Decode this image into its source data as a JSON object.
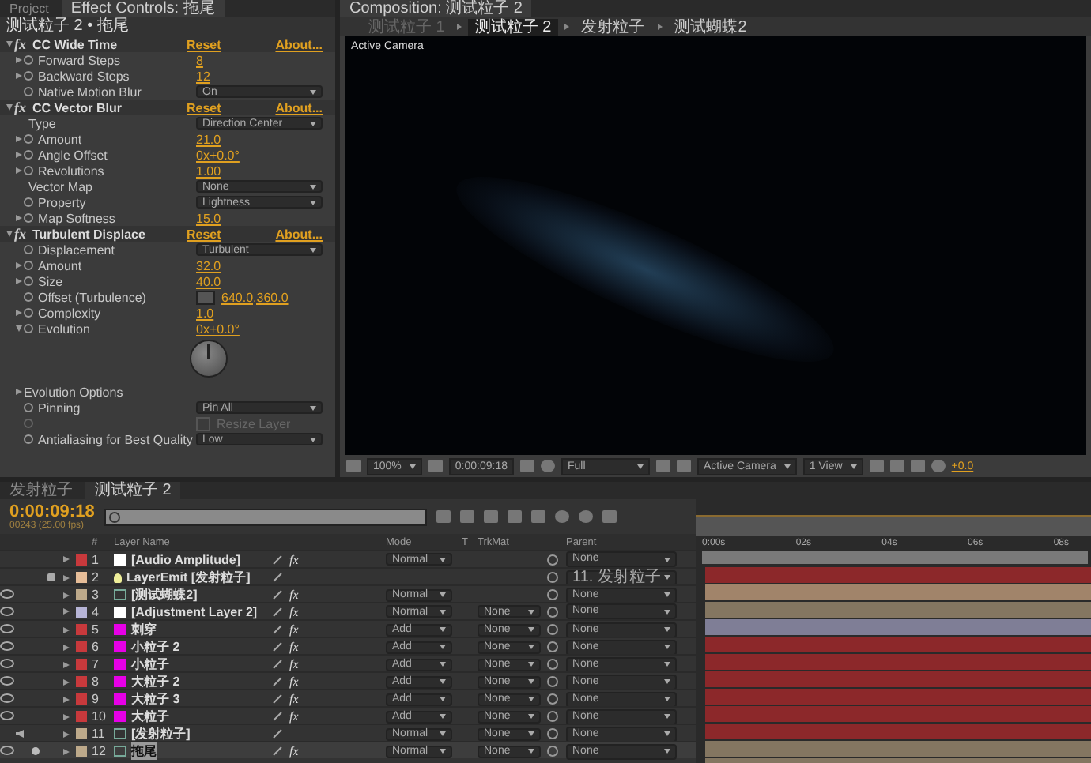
{
  "effect_panel": {
    "tabs": [
      {
        "label": "Project",
        "selected": false
      },
      {
        "label": "Effect Controls: 拖尾",
        "selected": true
      }
    ],
    "header": "测试粒子 2 • 拖尾",
    "effects": [
      {
        "name": "CC Wide Time",
        "badge": "fx",
        "reset": "Reset",
        "about": "About...",
        "expanded": true,
        "properties": [
          {
            "kind": "value",
            "label": "Forward Steps",
            "value": "8",
            "expander": true,
            "expanded": false,
            "stopwatch": true
          },
          {
            "kind": "value",
            "label": "Backward Steps",
            "value": "12",
            "expander": true,
            "expanded": false,
            "stopwatch": true
          },
          {
            "kind": "dropdown",
            "label": "Native Motion Blur",
            "value": "On",
            "expander": false,
            "stopwatch": true
          }
        ]
      },
      {
        "name": "CC Vector Blur",
        "badge": "fx",
        "reset": "Reset",
        "about": "About...",
        "expanded": true,
        "properties": [
          {
            "kind": "dropdown",
            "label": "Type",
            "value": "Direction Center",
            "expander": false,
            "stopwatch": false
          },
          {
            "kind": "value",
            "label": "Amount",
            "value": "21.0",
            "expander": true,
            "expanded": false,
            "stopwatch": true
          },
          {
            "kind": "value",
            "label": "Angle Offset",
            "value": "0x+0.0°",
            "expander": true,
            "expanded": false,
            "stopwatch": true
          },
          {
            "kind": "value",
            "label": "Revolutions",
            "value": "1.00",
            "expander": true,
            "expanded": false,
            "stopwatch": true
          },
          {
            "kind": "dropdown",
            "label": "Vector Map",
            "value": "None",
            "expander": false,
            "stopwatch": false
          },
          {
            "kind": "dropdown",
            "label": "Property",
            "value": "Lightness",
            "expander": false,
            "stopwatch": true
          },
          {
            "kind": "value",
            "label": "Map Softness",
            "value": "15.0",
            "expander": true,
            "expanded": false,
            "stopwatch": true
          }
        ]
      },
      {
        "name": "Turbulent Displace",
        "badge": "fx",
        "reset": "Reset",
        "about": "About...",
        "expanded": true,
        "properties": [
          {
            "kind": "dropdown",
            "label": "Displacement",
            "value": "Turbulent",
            "expander": false,
            "stopwatch": true
          },
          {
            "kind": "value",
            "label": "Amount",
            "value": "32.0",
            "expander": true,
            "expanded": false,
            "stopwatch": true
          },
          {
            "kind": "value",
            "label": "Size",
            "value": "40.0",
            "expander": true,
            "expanded": false,
            "stopwatch": true
          },
          {
            "kind": "point",
            "label": "Offset (Turbulence)",
            "value": "640.0,360.0",
            "expander": false,
            "stopwatch": true
          },
          {
            "kind": "value",
            "label": "Complexity",
            "value": "1.0",
            "expander": true,
            "expanded": false,
            "stopwatch": true
          },
          {
            "kind": "angle",
            "label": "Evolution",
            "value": "0x+0.0°",
            "expander": true,
            "expanded": true,
            "stopwatch": true
          },
          {
            "kind": "group",
            "label": "Evolution Options",
            "expander": true,
            "expanded": false,
            "stopwatch": false
          },
          {
            "kind": "dropdown",
            "label": "Pinning",
            "value": "Pin All",
            "expander": false,
            "stopwatch": true
          },
          {
            "kind": "checkbox",
            "label": "Resize Layer",
            "checked": false,
            "disabled": true,
            "expander": false,
            "stopwatch": true
          },
          {
            "kind": "dropdown",
            "label": "Antialiasing for Best Quality",
            "value": "Low",
            "expander": false,
            "stopwatch": true
          }
        ]
      }
    ]
  },
  "composition": {
    "tab": "Composition: 测试粒子 2",
    "breadcrumbs": [
      {
        "label": "测试粒子 1",
        "selected": false,
        "dimmed": true
      },
      {
        "label": "测试粒子 2",
        "selected": true,
        "dimmed": false
      },
      {
        "label": "发射粒子",
        "selected": false,
        "dimmed": false
      },
      {
        "label": "测试蝴蝶2",
        "selected": false,
        "dimmed": false
      }
    ],
    "camera_label": "Active Camera",
    "footer": {
      "zoom": "100%",
      "timecode": "0:00:09:18",
      "resolution": "Full",
      "camera": "Active Camera",
      "views": "1 View",
      "exposure": "+0.0"
    }
  },
  "timeline": {
    "tabs": [
      {
        "label": "发射粒子",
        "selected": false
      },
      {
        "label": "测试粒子 2",
        "selected": true
      }
    ],
    "timecode": "0:00:09:18",
    "frame_info": "00243 (25.00 fps)",
    "columns": {
      "number": "#",
      "layer_name": "Layer Name",
      "mode": "Mode",
      "t": "T",
      "trkmat": "TrkMat",
      "parent": "Parent"
    },
    "ruler": [
      "0:00s",
      "02s",
      "04s",
      "06s",
      "08s"
    ],
    "layers": [
      {
        "number": "1",
        "color": "#c8393c",
        "source": {
          "kind": "solid",
          "color": "#ffffff"
        },
        "name": "[Audio Amplitude]",
        "fx": "fx",
        "mode": "Normal",
        "parent": "None",
        "video": false,
        "audio": false,
        "solo": false,
        "locked": false,
        "selected": false
      },
      {
        "number": "2",
        "color": "#e6bd98",
        "source": {
          "kind": "light"
        },
        "name": "LayerEmit [发射粒子]",
        "parent": "11. 发射粒子",
        "video": false,
        "audio": false,
        "solo": false,
        "locked": true,
        "selected": false
      },
      {
        "number": "3",
        "color": "#bda98a",
        "source": {
          "kind": "comp"
        },
        "name": "[测试蝴蝶2]",
        "fx": "fx",
        "mode": "Normal",
        "parent": "None",
        "video": true,
        "audio": false,
        "solo": false,
        "locked": false,
        "selected": false
      },
      {
        "number": "4",
        "color": "#b6b4d6",
        "source": {
          "kind": "solid",
          "color": "#ffffff"
        },
        "name": "[Adjustment Layer 2]",
        "fx": "fx",
        "mode": "Normal",
        "trkmat": "None",
        "parent": "None",
        "video": true,
        "audio": false,
        "solo": false,
        "locked": false,
        "selected": false
      },
      {
        "number": "5",
        "color": "#c8393c",
        "source": {
          "kind": "solid",
          "color": "#e600e6"
        },
        "name": "刺穿",
        "fx": "fx",
        "mode": "Add",
        "trkmat": "None",
        "parent": "None",
        "video": true,
        "audio": false,
        "solo": false,
        "locked": false,
        "selected": false
      },
      {
        "number": "6",
        "color": "#c8393c",
        "source": {
          "kind": "solid",
          "color": "#e600e6"
        },
        "name": "小粒子 2",
        "fx": "fx",
        "mode": "Add",
        "trkmat": "None",
        "parent": "None",
        "video": true,
        "audio": false,
        "solo": false,
        "locked": false,
        "selected": false
      },
      {
        "number": "7",
        "color": "#c8393c",
        "source": {
          "kind": "solid",
          "color": "#e600e6"
        },
        "name": "小粒子",
        "fx": "fx",
        "mode": "Add",
        "trkmat": "None",
        "parent": "None",
        "video": true,
        "audio": false,
        "solo": false,
        "locked": false,
        "selected": false
      },
      {
        "number": "8",
        "color": "#c8393c",
        "source": {
          "kind": "solid",
          "color": "#e600e6"
        },
        "name": "大粒子 2",
        "fx": "fx",
        "mode": "Add",
        "trkmat": "None",
        "parent": "None",
        "video": true,
        "audio": false,
        "solo": false,
        "locked": false,
        "selected": false
      },
      {
        "number": "9",
        "color": "#c8393c",
        "source": {
          "kind": "solid",
          "color": "#e600e6"
        },
        "name": "大粒子 3",
        "fx": "fx",
        "mode": "Add",
        "trkmat": "None",
        "parent": "None",
        "video": true,
        "audio": false,
        "solo": false,
        "locked": false,
        "selected": false
      },
      {
        "number": "10",
        "color": "#c8393c",
        "source": {
          "kind": "solid",
          "color": "#e600e6"
        },
        "name": "大粒子",
        "fx": "fx",
        "mode": "Add",
        "trkmat": "None",
        "parent": "None",
        "video": true,
        "audio": false,
        "solo": false,
        "locked": false,
        "selected": false
      },
      {
        "number": "11",
        "color": "#bda98a",
        "source": {
          "kind": "comp"
        },
        "name": "[发射粒子]",
        "mode": "Normal",
        "trkmat": "None",
        "parent": "None",
        "video": false,
        "audio": true,
        "solo": false,
        "locked": false,
        "selected": false
      },
      {
        "number": "12",
        "color": "#bda98a",
        "source": {
          "kind": "comp"
        },
        "name": "拖尾",
        "fx": "fx",
        "mode": "Normal",
        "trkmat": "None",
        "parent": "None",
        "video": true,
        "audio": false,
        "solo": true,
        "locked": false,
        "selected": true
      }
    ]
  }
}
